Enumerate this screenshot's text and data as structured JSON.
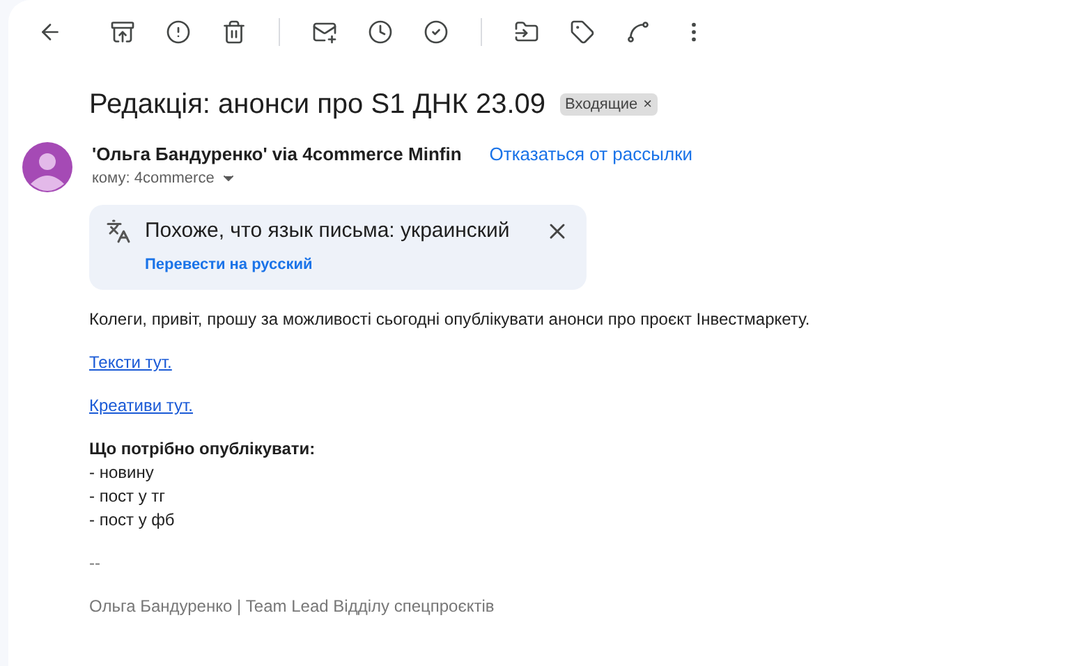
{
  "subject": {
    "title": "Редакція: анонси про S1 ДНК 23.09",
    "labels": [
      {
        "text": "Входящие",
        "remove": "×"
      }
    ]
  },
  "sender": {
    "name": "'Ольга Бандуренко' via 4commerce Minfin",
    "unsubscribe": "Отказаться от рассылки",
    "recipient": "кому: 4commerce"
  },
  "translate_banner": {
    "message": "Похоже, что язык письма: украинский",
    "action": "Перевести на русский"
  },
  "body": [
    {
      "kind": "text",
      "text": "Колеги, привіт, прошу за можливості сьогодні опублікувати анонси про проєкт Інвестмаркету."
    },
    {
      "kind": "link",
      "text": "Тексти тут."
    },
    {
      "kind": "link",
      "text": "Креативи тут."
    },
    {
      "kind": "list",
      "heading": "Що потрібно опублікувати:",
      "items": [
        "- новину",
        "- пост у тг",
        "- пост у фб"
      ]
    },
    {
      "kind": "signature",
      "text": "--"
    },
    {
      "kind": "signature",
      "text": "Ольга Бандуренко | Team Lead Відділу спецпроєктів"
    }
  ]
}
